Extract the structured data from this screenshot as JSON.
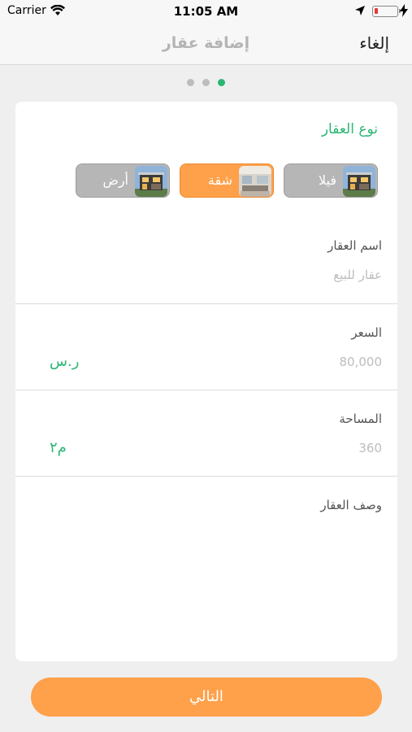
{
  "status_bar": {
    "carrier": "Carrier",
    "time": "11:05 AM"
  },
  "nav": {
    "title": "إضافة عقار",
    "cancel_label": "إلغاء"
  },
  "pager": {
    "total": 3,
    "active_index": 2
  },
  "property_type": {
    "title": "نوع العقار",
    "options": [
      {
        "label": "فيلا",
        "selected": false,
        "icon": "villa-thumbnail"
      },
      {
        "label": "شقة",
        "selected": true,
        "icon": "apartment-thumbnail"
      },
      {
        "label": "أرض",
        "selected": false,
        "icon": "land-thumbnail"
      }
    ]
  },
  "fields": {
    "name": {
      "label": "اسم العقار",
      "placeholder": "عقار للبيع"
    },
    "price": {
      "label": "السعر",
      "placeholder": "80,000",
      "unit": "ر.س"
    },
    "area": {
      "label": "المساحة",
      "placeholder": "360",
      "unit": "م٢"
    },
    "description": {
      "label": "وصف العقار"
    }
  },
  "next_button": {
    "label": "التالي"
  },
  "colors": {
    "accent_green": "#2bb673",
    "accent_orange": "#ffa04a",
    "inactive_gray": "#b6b6b6"
  }
}
